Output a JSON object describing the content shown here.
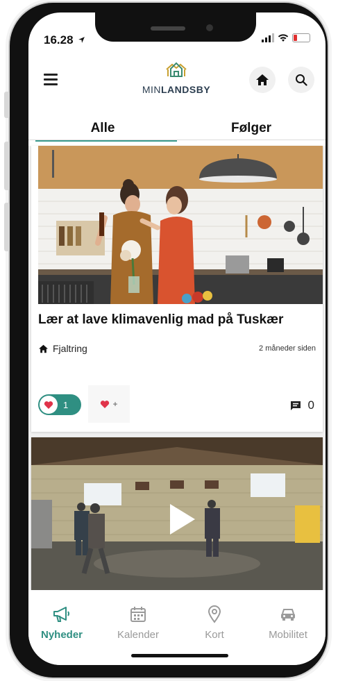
{
  "status_bar": {
    "time": "16.28"
  },
  "header": {
    "logo_main": "MIN",
    "logo_bold": "LANDSBY"
  },
  "tabs": [
    {
      "label": "Alle",
      "active": true
    },
    {
      "label": "Følger",
      "active": false
    }
  ],
  "posts": [
    {
      "title": "Lær at lave klimavenlig mad på Tuskær",
      "location": "Fjaltring",
      "time": "2 måneder siden",
      "likes": "1",
      "react_plus": "+",
      "comments": "0",
      "media": "image"
    },
    {
      "media": "video"
    }
  ],
  "bottom_nav": [
    {
      "label": "Nyheder",
      "icon": "megaphone-icon",
      "active": true
    },
    {
      "label": "Kalender",
      "icon": "calendar-icon",
      "active": false
    },
    {
      "label": "Kort",
      "icon": "map-pin-icon",
      "active": false
    },
    {
      "label": "Mobilitet",
      "icon": "car-icon",
      "active": false
    }
  ],
  "colors": {
    "accent": "#2f8f82",
    "heart": "#e0344a",
    "inactive": "#9a9a9a"
  }
}
